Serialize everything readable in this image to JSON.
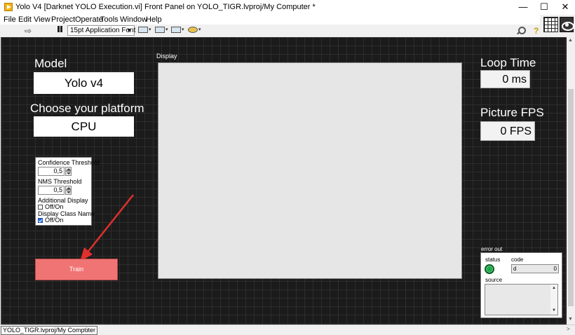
{
  "window": {
    "title": "Yolo V4 [Darknet YOLO Execution.vi] Front Panel on YOLO_TIGR.lvproj/My Computer *",
    "minimize": "—",
    "maximize": "☐",
    "close": "✕"
  },
  "menu": [
    "File",
    "Edit",
    "View",
    "Project",
    "Operate",
    "Tools",
    "Window",
    "Help"
  ],
  "toolbar": {
    "run": "⇨",
    "font": "15pt Application Font",
    "font_arrow": "▼",
    "dropdown_glyph": "▾",
    "help": "?"
  },
  "panel": {
    "model": {
      "label": "Model",
      "value": "Yolo v4"
    },
    "platform": {
      "label": "Choose your platform",
      "value": "CPU"
    },
    "params": {
      "confidence_label": "Confidence Threshold",
      "confidence_value": "0,5",
      "nms_label": "NMS Threshold",
      "nms_value": "0,5",
      "additional_label": "Additional Display",
      "additional_option": "Off/On",
      "additional_checked": false,
      "classname_label": "Display Class Name",
      "classname_option": "Off/On",
      "classname_checked": true
    },
    "train_label": "Train",
    "display_label": "Display",
    "loop_time": {
      "label": "Loop Time",
      "value": "0 ms"
    },
    "picture_fps": {
      "label": "Picture FPS",
      "value": "0 FPS"
    },
    "error_out": {
      "label": "error out",
      "status_label": "status",
      "code_label": "code",
      "code_prefix": "d",
      "code_value": "0",
      "source_label": "source",
      "scroll_up": "▲",
      "scroll_down": "▼"
    }
  },
  "colors": {
    "canvas": "#1b1b1b",
    "train_button": "#f07474",
    "status_led": "#1fa84a",
    "arrow": "#e0302c"
  },
  "scroll": {
    "up": "▲",
    "down": "▼",
    "left": "<",
    "right": ">"
  },
  "statusbar": {
    "path": "YOLO_TIGR.lvproj/My Computer"
  }
}
